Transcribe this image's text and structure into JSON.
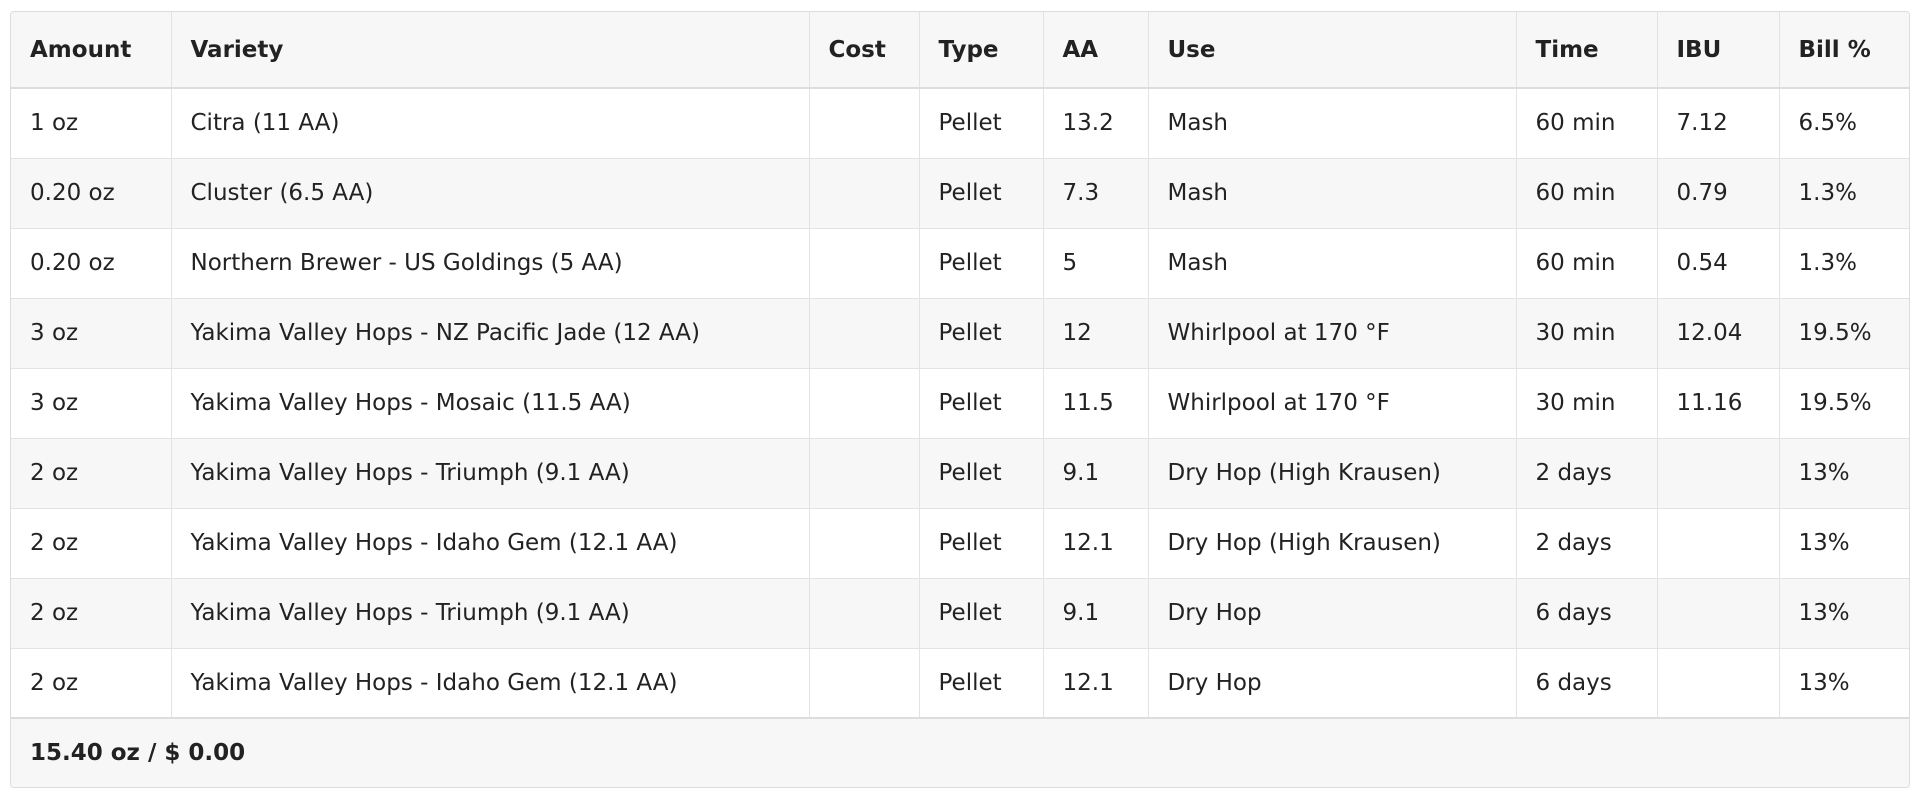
{
  "hops_table": {
    "columns": [
      "Amount",
      "Variety",
      "Cost",
      "Type",
      "AA",
      "Use",
      "Time",
      "IBU",
      "Bill %"
    ],
    "rows": [
      {
        "amount": "1 oz",
        "variety": "Citra (11 AA)",
        "cost": "",
        "type": "Pellet",
        "aa": "13.2",
        "use": "Mash",
        "time": "60 min",
        "ibu": "7.12",
        "bill": "6.5%"
      },
      {
        "amount": "0.20 oz",
        "variety": "Cluster (6.5 AA)",
        "cost": "",
        "type": "Pellet",
        "aa": "7.3",
        "use": "Mash",
        "time": "60 min",
        "ibu": "0.79",
        "bill": "1.3%"
      },
      {
        "amount": "0.20 oz",
        "variety": "Northern Brewer - US Goldings (5 AA)",
        "cost": "",
        "type": "Pellet",
        "aa": "5",
        "use": "Mash",
        "time": "60 min",
        "ibu": "0.54",
        "bill": "1.3%"
      },
      {
        "amount": "3 oz",
        "variety": "Yakima Valley Hops - NZ Pacific Jade (12 AA)",
        "cost": "",
        "type": "Pellet",
        "aa": "12",
        "use": "Whirlpool at 170 °F",
        "time": "30 min",
        "ibu": "12.04",
        "bill": "19.5%"
      },
      {
        "amount": "3 oz",
        "variety": "Yakima Valley Hops - Mosaic (11.5 AA)",
        "cost": "",
        "type": "Pellet",
        "aa": "11.5",
        "use": "Whirlpool at 170 °F",
        "time": "30 min",
        "ibu": "11.16",
        "bill": "19.5%"
      },
      {
        "amount": "2 oz",
        "variety": "Yakima Valley Hops - Triumph (9.1 AA)",
        "cost": "",
        "type": "Pellet",
        "aa": "9.1",
        "use": "Dry Hop (High Krausen)",
        "time": "2 days",
        "ibu": "",
        "bill": "13%"
      },
      {
        "amount": "2 oz",
        "variety": "Yakima Valley Hops - Idaho Gem (12.1 AA)",
        "cost": "",
        "type": "Pellet",
        "aa": "12.1",
        "use": "Dry Hop (High Krausen)",
        "time": "2 days",
        "ibu": "",
        "bill": "13%"
      },
      {
        "amount": "2 oz",
        "variety": "Yakima Valley Hops - Triumph (9.1 AA)",
        "cost": "",
        "type": "Pellet",
        "aa": "9.1",
        "use": "Dry Hop",
        "time": "6 days",
        "ibu": "",
        "bill": "13%"
      },
      {
        "amount": "2 oz",
        "variety": "Yakima Valley Hops - Idaho Gem (12.1 AA)",
        "cost": "",
        "type": "Pellet",
        "aa": "12.1",
        "use": "Dry Hop",
        "time": "6 days",
        "ibu": "",
        "bill": "13%"
      }
    ],
    "footer_total": "15.40 oz / $ 0.00"
  }
}
